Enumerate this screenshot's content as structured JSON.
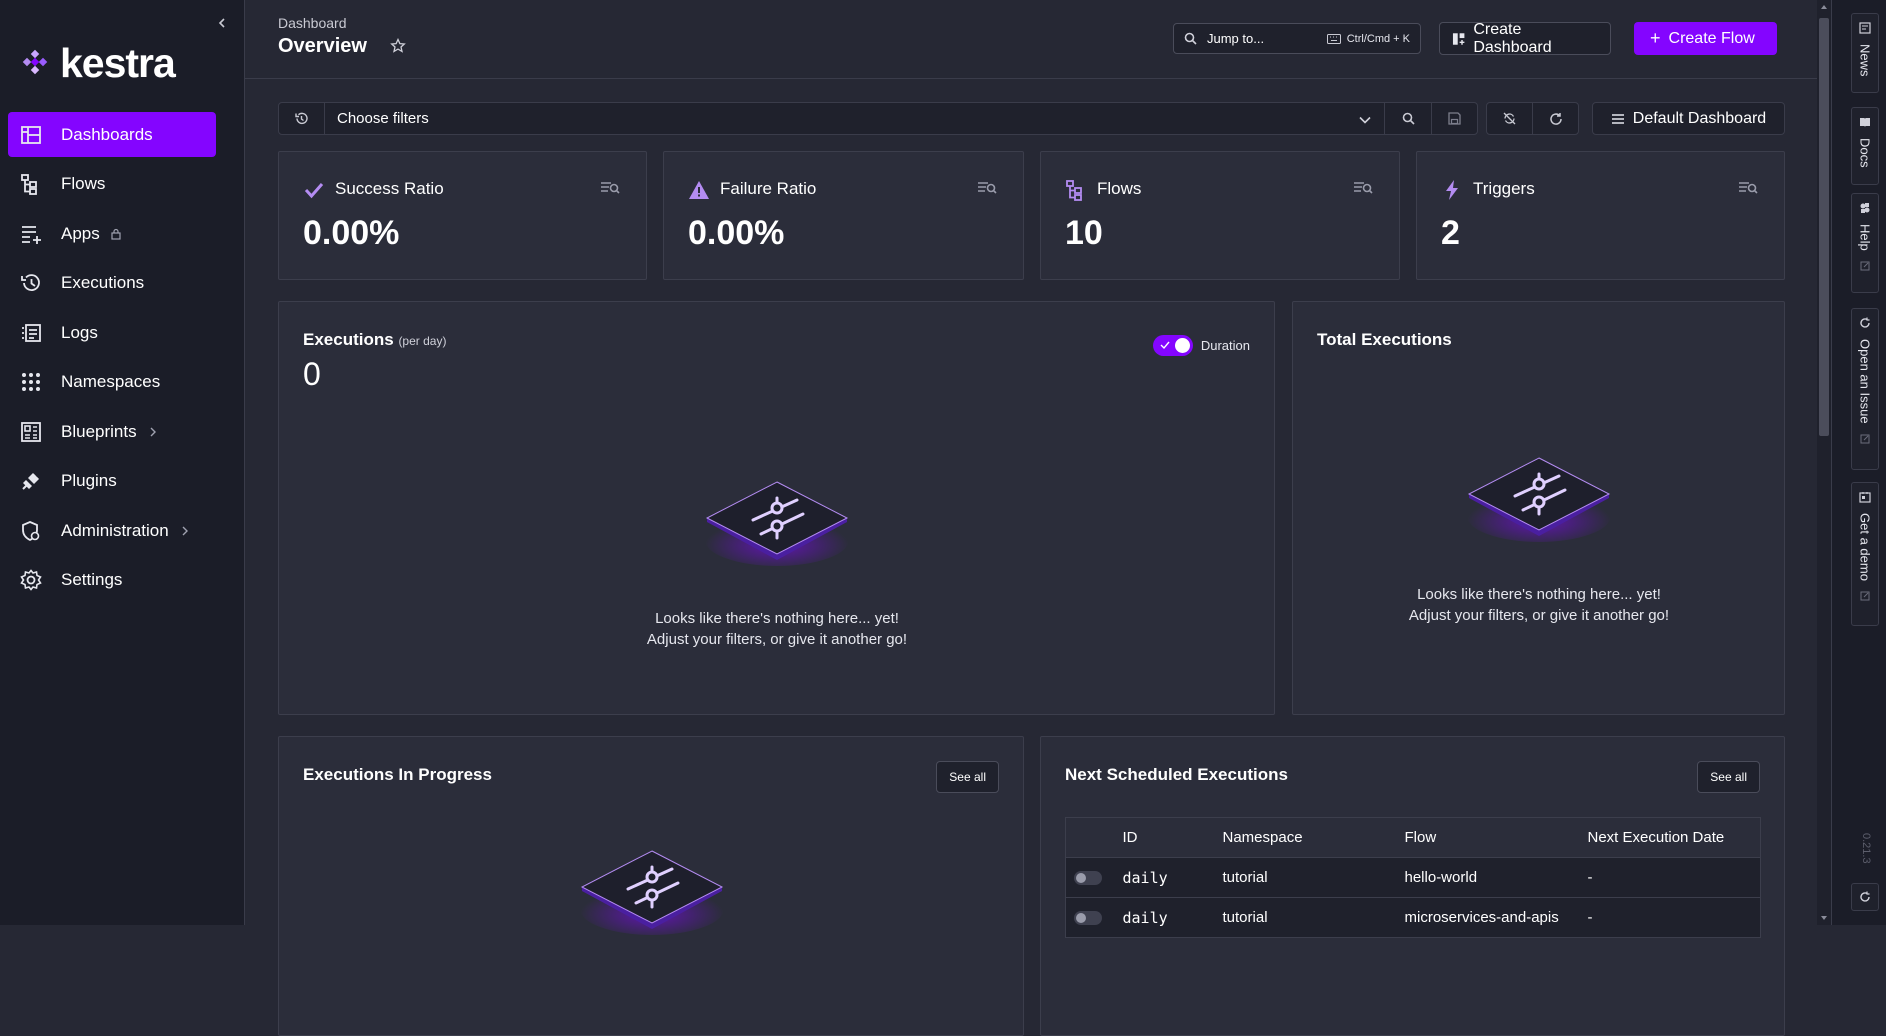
{
  "sidebar": {
    "logo_text": "kestra",
    "items": [
      {
        "label": "Dashboards",
        "icon": "dashboard-icon"
      },
      {
        "label": "Flows",
        "icon": "flows-icon"
      },
      {
        "label": "Apps",
        "icon": "apps-icon"
      },
      {
        "label": "Executions",
        "icon": "executions-icon"
      },
      {
        "label": "Logs",
        "icon": "logs-icon"
      },
      {
        "label": "Namespaces",
        "icon": "namespaces-icon"
      },
      {
        "label": "Blueprints",
        "icon": "blueprints-icon"
      },
      {
        "label": "Plugins",
        "icon": "plugins-icon"
      },
      {
        "label": "Administration",
        "icon": "administration-icon"
      },
      {
        "label": "Settings",
        "icon": "settings-icon"
      }
    ],
    "active": "Dashboards"
  },
  "header": {
    "breadcrumb": "Dashboard",
    "title": "Overview",
    "jump_placeholder": "Jump to...",
    "jump_shortcut": "Ctrl/Cmd + K",
    "create_dashboard": "Create Dashboard",
    "create_flow": "Create Flow"
  },
  "filters": {
    "placeholder": "Choose filters",
    "dashboard_select": "Default Dashboard"
  },
  "kpis": [
    {
      "label": "Success Ratio",
      "value": "0.00%",
      "icon": "check-icon"
    },
    {
      "label": "Failure Ratio",
      "value": "0.00%",
      "icon": "warning-icon"
    },
    {
      "label": "Flows",
      "value": "10",
      "icon": "flows-icon"
    },
    {
      "label": "Triggers",
      "value": "2",
      "icon": "lightning-icon"
    }
  ],
  "executions_panel": {
    "title": "Executions",
    "subtitle": "(per day)",
    "count": "0",
    "toggle_label": "Duration",
    "empty_line1": "Looks like there's nothing here... yet!",
    "empty_line2": "Adjust your filters, or give it another go!"
  },
  "total_panel": {
    "title": "Total Executions",
    "empty_line1": "Looks like there's nothing here... yet!",
    "empty_line2": "Adjust your filters, or give it another go!"
  },
  "in_progress_panel": {
    "title": "Executions In Progress",
    "see_all": "See all"
  },
  "scheduled_panel": {
    "title": "Next Scheduled Executions",
    "see_all": "See all",
    "columns": [
      "ID",
      "Namespace",
      "Flow",
      "Next Execution Date"
    ],
    "rows": [
      {
        "id": "daily",
        "namespace": "tutorial",
        "flow": "hello-world",
        "next": "-"
      },
      {
        "id": "daily",
        "namespace": "tutorial",
        "flow": "microservices-and-apis",
        "next": "-"
      }
    ]
  },
  "rail": {
    "items": [
      "News",
      "Docs",
      "Help",
      "Open an Issue",
      "Get a demo"
    ],
    "version": "0.21.3"
  },
  "colors": {
    "accent": "#8405ff",
    "background": "#262834",
    "sidebar": "#1b1d28",
    "card": "#2b2d3a",
    "icon_purple": "#b48cf2"
  }
}
